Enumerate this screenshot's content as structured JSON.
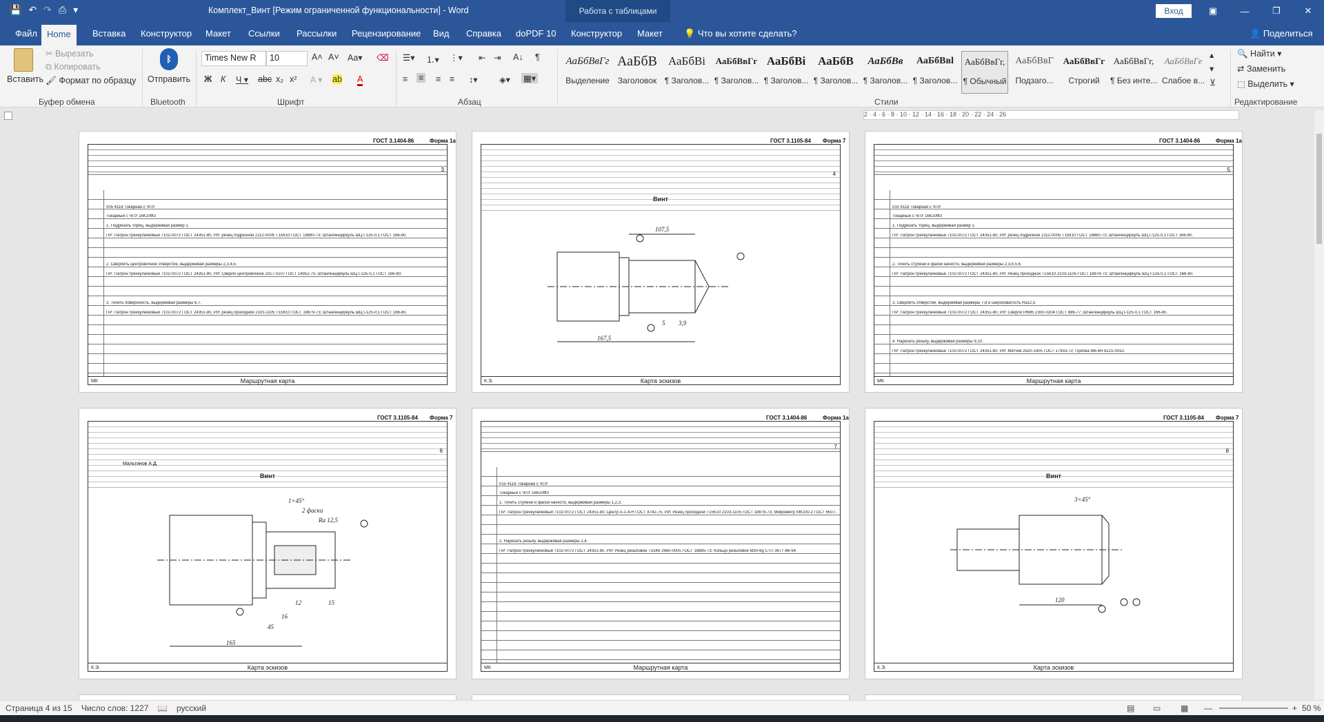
{
  "window": {
    "title": "Комплект_Винт [Режим ограниченной функциональности]  -  Word",
    "context_label": "Работа с таблицами",
    "login": "Вход"
  },
  "tabs": [
    "Файл",
    "Home",
    "Вставка",
    "Конструктор",
    "Макет",
    "Ссылки",
    "Рассылки",
    "Рецензирование",
    "Вид",
    "Справка",
    "doPDF 10",
    "Конструктор",
    "Макет"
  ],
  "tell_me": "Что вы хотите сделать?",
  "share": "Поделиться",
  "ribbon": {
    "clipboard": {
      "paste": "Вставить",
      "cut": "Вырезать",
      "copy": "Копировать",
      "format": "Формат по образцу",
      "label": "Буфер обмена"
    },
    "bluetooth": {
      "send": "Отправить",
      "label": "Bluetooth"
    },
    "font": {
      "name": "Times New R",
      "size": "10",
      "label": "Шрифт"
    },
    "paragraph": {
      "label": "Абзац"
    },
    "styles": {
      "label": "Стили",
      "items": [
        {
          "sample": "АаБбВвГг",
          "name": "Выделение"
        },
        {
          "sample": "АаБбВ",
          "name": "Заголовок"
        },
        {
          "sample": "АаБбВі",
          "name": "¶ Заголов..."
        },
        {
          "sample": "АаБбВвГг",
          "name": "¶ Заголов..."
        },
        {
          "sample": "АаБбВі",
          "name": "¶ Заголов..."
        },
        {
          "sample": "АаБбВ",
          "name": "¶ Заголов..."
        },
        {
          "sample": "АаБбВв",
          "name": "¶ Заголов..."
        },
        {
          "sample": "АаБбВвl",
          "name": "¶ Заголов..."
        },
        {
          "sample": "АаБбВвГг,",
          "name": "¶ Обычный"
        },
        {
          "sample": "АаБбВвГ",
          "name": "Подзаго..."
        },
        {
          "sample": "АаБбВвГг",
          "name": "Строгий"
        },
        {
          "sample": "АаБбВвГг,",
          "name": "¶ Без инте..."
        },
        {
          "sample": "АаБбВвГе",
          "name": "Слабое в..."
        }
      ]
    },
    "editing": {
      "find": "Найти",
      "replace": "Заменить",
      "select": "Выделить",
      "label": "Редактирование"
    }
  },
  "ruler": "2 · 4 · 6 · 8 · 10 · 12 · 14 · 16 · 18 · 20 · 22 · 24 · 26",
  "pages": [
    {
      "gost": "ГОСТ 3.1404-86",
      "form": "Форма 1а",
      "num": "3",
      "footer": "Маршрутная карта",
      "mk": "МК",
      "rows": [
        "005  4118  Токарная с ЧПУ",
        "Токарный с ЧПУ 16К20Ф3",
        "1. Подрезать торец, выдерживая размер 1.",
        "ПР: Патрон трехкулачковый 7102-0072 ГОСТ 24351-80, РИ: резец подрезной 2112-0005 Т15К10 ГОСТ 18880-73; Штангенциркуль ШЦ I-125-0,1 ГОСТ 166-80.",
        "2. Сверлить центровочное отверстие, выдерживая размеры 2,3,4,5.",
        "ПР: Патрон трехкулачковый 7102-0072 ГОСТ 24351-80, РИ: Сверло центровочное 2317-0107 ГОСТ 14952-75; Штангенциркуль ШЦ I-125-0,1 ГОСТ 166-80.",
        "3. Точить поверхность, выдерживая размеры 6,7.",
        "ПР: Патрон трехкулачковый 7102-0072 ГОСТ 24351-80, РИ: резец проходной 2103-1105 Т15К10 ГОСТ 18879-73; Штангенциркуль ШЦ I-125-0,1 ГОСТ 166-80."
      ]
    },
    {
      "gost": "ГОСТ 3.1105-84",
      "form": "Форма 7",
      "num": "4",
      "footer": "Карта эскизов",
      "mk": "К.Э.",
      "part": "Винт"
    },
    {
      "gost": "ГОСТ 3.1404-86",
      "form": "Форма 1а",
      "num": "5",
      "footer": "Маршрутная карта",
      "mk": "МК",
      "rows": [
        "010  4118  Токарная с ЧПУ",
        "Токарный с ЧПУ 16К20Ф3",
        "1. Подрезать торец, выдерживая размер 1.",
        "ПР: Патрон трехкулачковый 7102-0072 ГОСТ 24351-80, РИ: резец подрезной 2112-0005 Т15К10 ГОСТ 18880-73; Штангенциркуль ШЦ I-125-0,1 ГОСТ 166-80.",
        "2. Точить ступени и фаски начисто, выдерживая размеры 2,3,4,5,6.",
        "ПР: Патрон трехкулачковый 7102-0072 ГОСТ 24351-80, РИ: Резец проходной Т15К10 2103-1105 ГОСТ 18879-73; Штангенциркуль ШЦ I-125-0,1 ГОСТ 166-80.",
        "3. Сверлить отверстие, выдерживая размеры 7,8 и шероховатость Ra12,5",
        "ПР: Патрон трехкулачковый 7102-0072 ГОСТ 24351-80, РИ: Сверло Р6М5 2300-0204 ГОСТ 886-77; Штангенциркуль ШЦ I-125-0,1 ГОСТ 166-80.",
        "4. Нарезать резьбу, выдерживая размеры 9,10.",
        "ПР: Патрон трехкулачковый 7102-0072 ГОСТ 24351-80, РИ: Метчик 2620-1405 ГОСТ 17933-72; Пробка М6-6Н 8221-0032."
      ]
    },
    {
      "gost": "ГОСТ 3.1105-84",
      "form": "Форма 7",
      "num": "6",
      "footer": "Карта эскизов",
      "mk": "К.Э.",
      "part": "Винт",
      "developer": "Мальгинов А.Д."
    },
    {
      "gost": "ГОСТ 3.1404-86",
      "form": "Форма 1а",
      "num": "7",
      "footer": "Маршрутная карта",
      "mk": "МК",
      "rows": [
        "015  4118  Токарная с ЧПУ",
        "Токарный с ЧПУ 16К20Ф3",
        "1. Точить ступени и фаски начисто, выдерживая размеры 1,2,3.",
        "ПР: Патрон трехкулачковый 7102-0072 ГОСТ 24351-80; Центр А-1-4-Н ГОСТ 8742-75. РИ: Резец проходной Т15К10 2103-1105 ГОСТ 18879-73; Микрометр МК100-2 ГОСТ 6507-78.",
        "2. Нарезать резьбу, выдерживая размеры 2,4.",
        "ПР: Патрон трехкулачковый 7102-0072 ГОСТ 24351-80, РИ: Резец резьбовой Т15К6 2660-0005 ГОСТ 18885-73; Кольцо резьбовое М30-6g СТП 3677-86-94."
      ]
    },
    {
      "gost": "ГОСТ 3.1105-84",
      "form": "Форма 7",
      "num": "8",
      "footer": "Карта эскизов",
      "mk": "К.Э.",
      "part": "Винт"
    }
  ],
  "status": {
    "page": "Страница 4 из 15",
    "words": "Число слов: 1227",
    "lang": "русский",
    "zoom": "50 %"
  }
}
